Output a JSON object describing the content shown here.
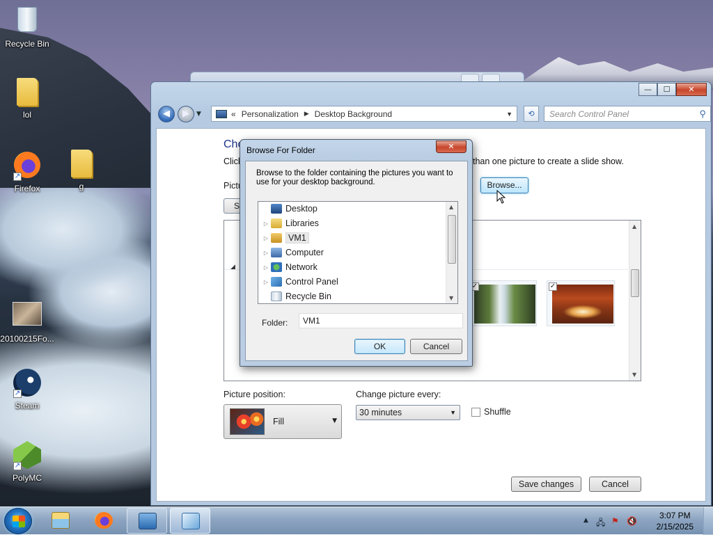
{
  "desktop": {
    "icons": [
      {
        "label": "Recycle Bin"
      },
      {
        "label": "lol"
      },
      {
        "label": "Firefox"
      },
      {
        "label": "g"
      },
      {
        "label": "20100215Fo..."
      },
      {
        "label": "Steam"
      },
      {
        "label": "PolyMC"
      }
    ]
  },
  "control_panel": {
    "breadcrumb_prefix": "«",
    "breadcrumb": [
      "Personalization",
      "Desktop Background"
    ],
    "search_placeholder": "Search Control Panel",
    "heading_fragment": "Cho",
    "desc_fragment_left": "Click",
    "desc_fragment_right": "than one picture to create a slide show.",
    "location_fragment": "Pictu",
    "select_fragment": "Se",
    "browse_label": "Browse...",
    "picture_position_label": "Picture position:",
    "picture_position_value": "Fill",
    "change_every_label": "Change picture every:",
    "change_every_value": "30 minutes",
    "shuffle_label": "Shuffle",
    "shuffle_checked": false,
    "save_label": "Save changes",
    "cancel_label": "Cancel",
    "thumbnails": [
      {
        "name": "waterfall",
        "checked": true
      },
      {
        "name": "rock-arch",
        "checked": true
      }
    ]
  },
  "dialog": {
    "title": "Browse For Folder",
    "close_label": "✕",
    "instructions": "Browse to the folder containing the pictures you want to use for your desktop background.",
    "tree": [
      {
        "label": "Desktop",
        "icon": "desktop-icon",
        "expandable": false
      },
      {
        "label": "Libraries",
        "icon": "libraries-icon",
        "expandable": true
      },
      {
        "label": "VM1",
        "icon": "user-folder-icon",
        "expandable": true,
        "selected": true
      },
      {
        "label": "Computer",
        "icon": "computer-icon",
        "expandable": true
      },
      {
        "label": "Network",
        "icon": "network-icon",
        "expandable": true
      },
      {
        "label": "Control Panel",
        "icon": "control-panel-icon",
        "expandable": true
      },
      {
        "label": "Recycle Bin",
        "icon": "recycle-bin-icon",
        "expandable": false
      }
    ],
    "folder_label": "Folder:",
    "folder_value": "VM1",
    "ok_label": "OK",
    "cancel_label": "Cancel"
  },
  "taskbar": {
    "clock_time": "3:07 PM",
    "clock_date": "2/15/2025"
  }
}
